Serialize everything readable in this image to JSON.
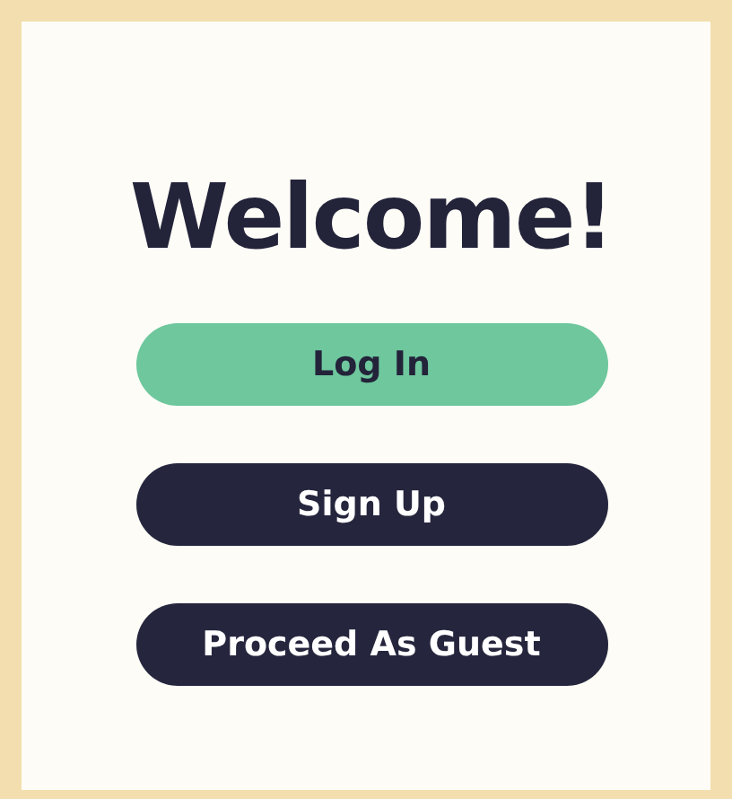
{
  "title": "Welcome!",
  "buttons": [
    {
      "label": "Log In",
      "kind": "primary"
    },
    {
      "label": "Sign Up",
      "kind": "secondary"
    },
    {
      "label": "Proceed As Guest",
      "kind": "secondary"
    }
  ]
}
